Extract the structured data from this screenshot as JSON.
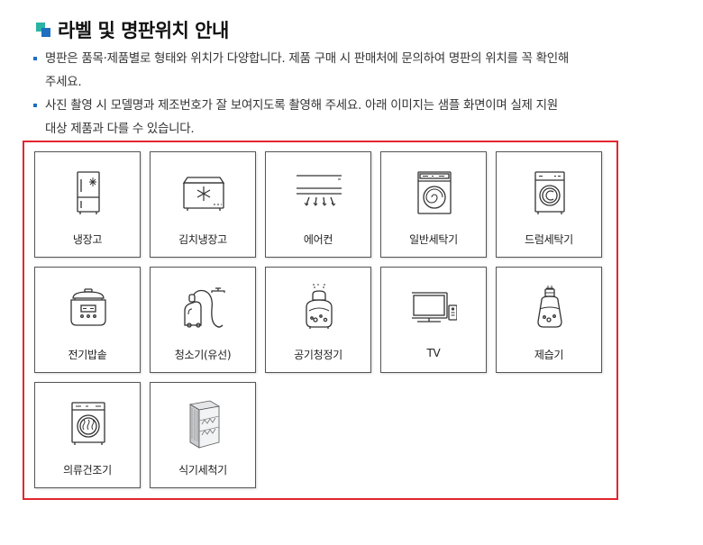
{
  "header": {
    "title": "라벨 및 명판위치 안내"
  },
  "notes": [
    {
      "line1": "명판은 품목·제품별로 형태와 위치가 다양합니다. 제품 구매 시 판매처에 문의하여 명판의 위치를 꼭 확인해",
      "line2": "주세요."
    },
    {
      "line1": "사진 촬영 시 모델명과 제조번호가 잘 보여지도록 촬영해 주세요. 아래 이미지는 샘플 화면이며 실제 지원",
      "line2": "대상 제품과 다를 수 있습니다."
    }
  ],
  "products": [
    {
      "label": "냉장고",
      "icon": "refrigerator-icon"
    },
    {
      "label": "김치냉장고",
      "icon": "kimchi-refrigerator-icon"
    },
    {
      "label": "에어컨",
      "icon": "air-conditioner-icon"
    },
    {
      "label": "일반세탁기",
      "icon": "washing-machine-icon"
    },
    {
      "label": "드럼세탁기",
      "icon": "drum-washer-icon"
    },
    {
      "label": "전기밥솥",
      "icon": "rice-cooker-icon"
    },
    {
      "label": "청소기(유선)",
      "icon": "vacuum-cleaner-icon"
    },
    {
      "label": "공기청정기",
      "icon": "air-purifier-icon"
    },
    {
      "label": "TV",
      "icon": "tv-icon"
    },
    {
      "label": "제습기",
      "icon": "dehumidifier-icon"
    },
    {
      "label": "의류건조기",
      "icon": "clothes-dryer-icon"
    },
    {
      "label": "식기세척기",
      "icon": "dishwasher-icon"
    }
  ],
  "colors": {
    "frame": "#e3262e",
    "accent": "#1f6fc0",
    "accent2": "#2bb3a3"
  }
}
